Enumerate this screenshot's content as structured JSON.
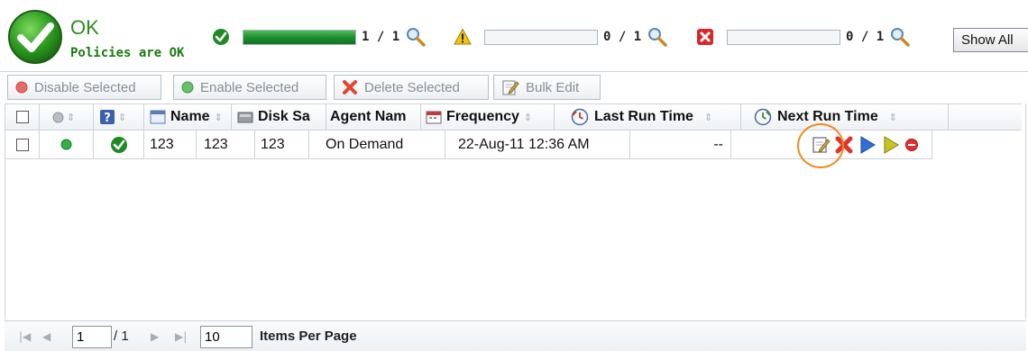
{
  "status": {
    "title": "OK",
    "subtitle": "Policies are OK",
    "ok": {
      "count": "1 / 1",
      "fraction": 1.0,
      "color": "#1c8a2c"
    },
    "warning": {
      "count": "0 / 1",
      "fraction": 0.0
    },
    "error": {
      "count": "0 / 1",
      "fraction": 0.0
    },
    "show_all_label": "Show All"
  },
  "toolbar": {
    "disable_label": "Disable Selected",
    "enable_label": "Enable Selected",
    "delete_label": "Delete Selected",
    "bulk_edit_label": "Bulk Edit"
  },
  "grid": {
    "columns": {
      "name": "Name",
      "disk": "Disk Sa",
      "agent": "Agent Nam",
      "frequency": "Frequency",
      "last_run": "Last Run Time",
      "next_run": "Next Run Time"
    },
    "rows": [
      {
        "name": "123",
        "disk": "123",
        "agent": "123",
        "frequency": "On Demand",
        "last_run": "22-Aug-11 12:36 AM",
        "next_run": "--"
      }
    ]
  },
  "pager": {
    "page": "1",
    "total": "/ 1",
    "per_page": "10",
    "per_page_label": "Items Per Page"
  },
  "colors": {
    "ok_green": "#2e8b1e",
    "warning_yellow": "#f2c417",
    "error_red": "#d8262b",
    "highlight_orange": "#f08a1a"
  }
}
